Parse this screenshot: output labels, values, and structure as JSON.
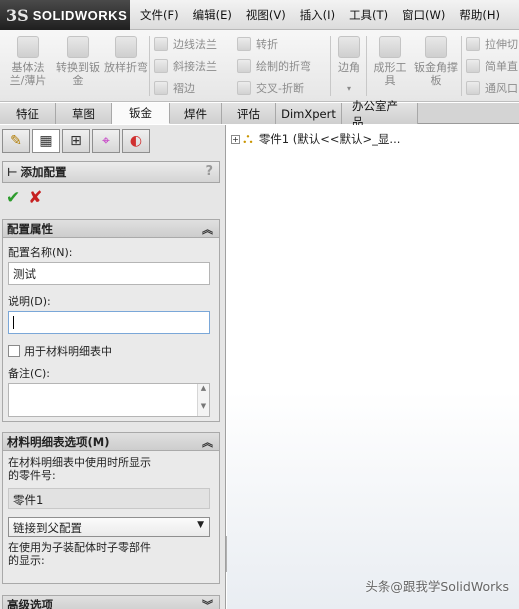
{
  "app": {
    "logo_mark": "3S",
    "logo_text": "SOLIDWORKS"
  },
  "menu": [
    "文件(F)",
    "编辑(E)",
    "视图(V)",
    "插入(I)",
    "工具(T)",
    "窗口(W)",
    "帮助(H)"
  ],
  "ribbon": {
    "big": [
      {
        "label": "基体法兰/薄片",
        "icon": "base-flange-icon"
      },
      {
        "label": "转换到钣金",
        "icon": "convert-to-sheet-metal-icon"
      },
      {
        "label": "放样折弯",
        "icon": "lofted-bend-icon"
      }
    ],
    "col1": [
      "边线法兰",
      "斜接法兰",
      "褶边"
    ],
    "col2": [
      "转折",
      "绘制的折弯",
      "交叉-折断"
    ],
    "corner": "边角",
    "big2": [
      {
        "label": "成形工具",
        "icon": "forming-tool-icon"
      },
      {
        "label": "钣金角撑板",
        "icon": "gusset-icon"
      }
    ],
    "col3": [
      "拉伸切",
      "简单直",
      "通风口"
    ]
  },
  "tabs": [
    "特征",
    "草图",
    "钣金",
    "焊件",
    "评估",
    "DimXpert",
    "办公室产品"
  ],
  "active_tab": "钣金",
  "panel": {
    "tabs": [
      "✎",
      "▦",
      "⊞",
      "⌖",
      "◐"
    ],
    "title": "添加配置",
    "help": "?",
    "config_props": {
      "title": "配置属性",
      "name_label": "配置名称(N):",
      "name_value": "测试",
      "desc_label": "说明(D):",
      "desc_value": "",
      "bom_check_label": "用于材料明细表中",
      "notes_label": "备注(C):"
    },
    "bom_options": {
      "title": "材料明细表选项(M)",
      "desc": "在材料明细表中使用时所显示的零件号:",
      "part_number": "零件1",
      "link_option": "链接到父配置",
      "child_desc": "在使用为子装配体时子零部件的显示:"
    },
    "advanced": {
      "title": "高级选项"
    }
  },
  "tree": {
    "root": "零件1  (默认<<默认>_显..."
  },
  "watermark": "头条@跟我学SolidWorks"
}
